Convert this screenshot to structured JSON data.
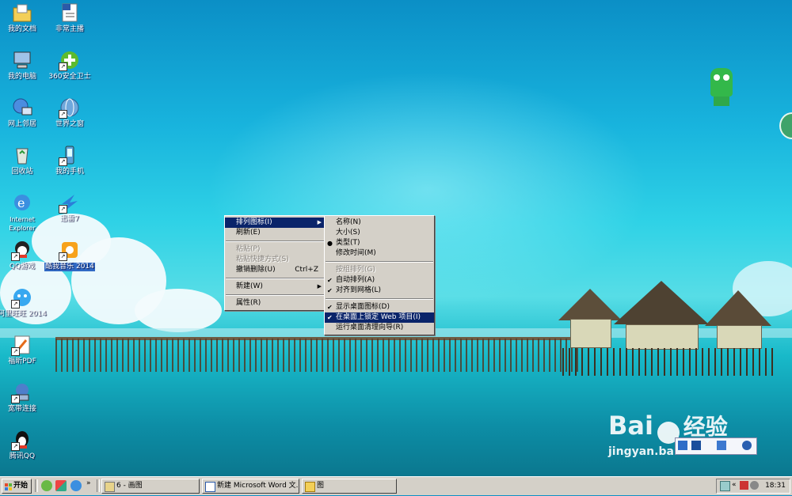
{
  "desktop": {
    "icons_col1": [
      {
        "label": "我的文档",
        "icon": "my-documents-icon"
      },
      {
        "label": "我的电脑",
        "icon": "my-computer-icon"
      },
      {
        "label": "网上邻居",
        "icon": "network-places-icon"
      },
      {
        "label": "回收站",
        "icon": "recycle-bin-icon"
      },
      {
        "label": "Internet Explorer",
        "icon": "internet-explorer-icon"
      },
      {
        "label": "QQ游戏",
        "icon": "qq-game-icon"
      },
      {
        "label": "阿里旺旺 2014",
        "icon": "aliwangwang-icon"
      },
      {
        "label": "福昕PDF",
        "icon": "foxit-pdf-icon"
      },
      {
        "label": "宽带连接",
        "icon": "broadband-connection-icon"
      },
      {
        "label": "腾讯QQ",
        "icon": "tencent-qq-icon"
      }
    ],
    "icons_col2": [
      {
        "label": "非常主播",
        "icon": "word-document-icon"
      },
      {
        "label": "360安全卫士",
        "icon": "360-security-icon"
      },
      {
        "label": "世界之窗",
        "icon": "theworld-browser-icon"
      },
      {
        "label": "我的手机",
        "icon": "my-phone-icon"
      },
      {
        "label": "迅雷7",
        "icon": "xunlei-icon"
      },
      {
        "label": "酷我音乐 2014",
        "icon": "kuwo-music-icon"
      }
    ]
  },
  "context_menu": {
    "items": [
      {
        "label": "排列图标(I)",
        "state": "highlighted",
        "submenu": true
      },
      {
        "label": "刷新(E)",
        "state": "normal"
      },
      {
        "sep": true
      },
      {
        "label": "粘贴(P)",
        "state": "disabled"
      },
      {
        "label": "粘贴快捷方式(S)",
        "state": "disabled"
      },
      {
        "label": "撤销删除(U)",
        "accel": "Ctrl+Z",
        "state": "normal"
      },
      {
        "sep": true
      },
      {
        "label": "新建(W)",
        "state": "normal",
        "submenu": true
      },
      {
        "sep": true
      },
      {
        "label": "属性(R)",
        "state": "normal"
      }
    ]
  },
  "submenu": {
    "items": [
      {
        "label": "名称(N)",
        "mark": ""
      },
      {
        "label": "大小(S)",
        "mark": ""
      },
      {
        "label": "类型(T)",
        "mark": "●"
      },
      {
        "label": "修改时间(M)",
        "mark": ""
      },
      {
        "sep": true
      },
      {
        "label": "按组排列(G)",
        "mark": "",
        "state": "disabled"
      },
      {
        "label": "自动排列(A)",
        "mark": "✔"
      },
      {
        "label": "对齐到网格(L)",
        "mark": "✔"
      },
      {
        "sep": true
      },
      {
        "label": "显示桌面图标(D)",
        "mark": "✔"
      },
      {
        "label": "在桌面上锁定 Web 项目(I)",
        "mark": "✔",
        "state": "highlighted"
      },
      {
        "label": "运行桌面清理向导(R)",
        "mark": ""
      }
    ]
  },
  "taskbar": {
    "start_label": "开始",
    "tasks": [
      {
        "label": "6 - 画图",
        "icon": "paint-icon"
      },
      {
        "label": "新建 Microsoft Word 文...",
        "icon": "word-icon"
      },
      {
        "label": "图",
        "icon": "folder-icon"
      }
    ],
    "tray_chevron": "«",
    "clock": "18:31"
  },
  "watermark": {
    "logo_text": "Bai",
    "logo_text2": "经验",
    "url": "jingyan.baidu.com"
  },
  "colors": {
    "menu_bg": "#d4d0c8",
    "highlight": "#0a246a"
  }
}
